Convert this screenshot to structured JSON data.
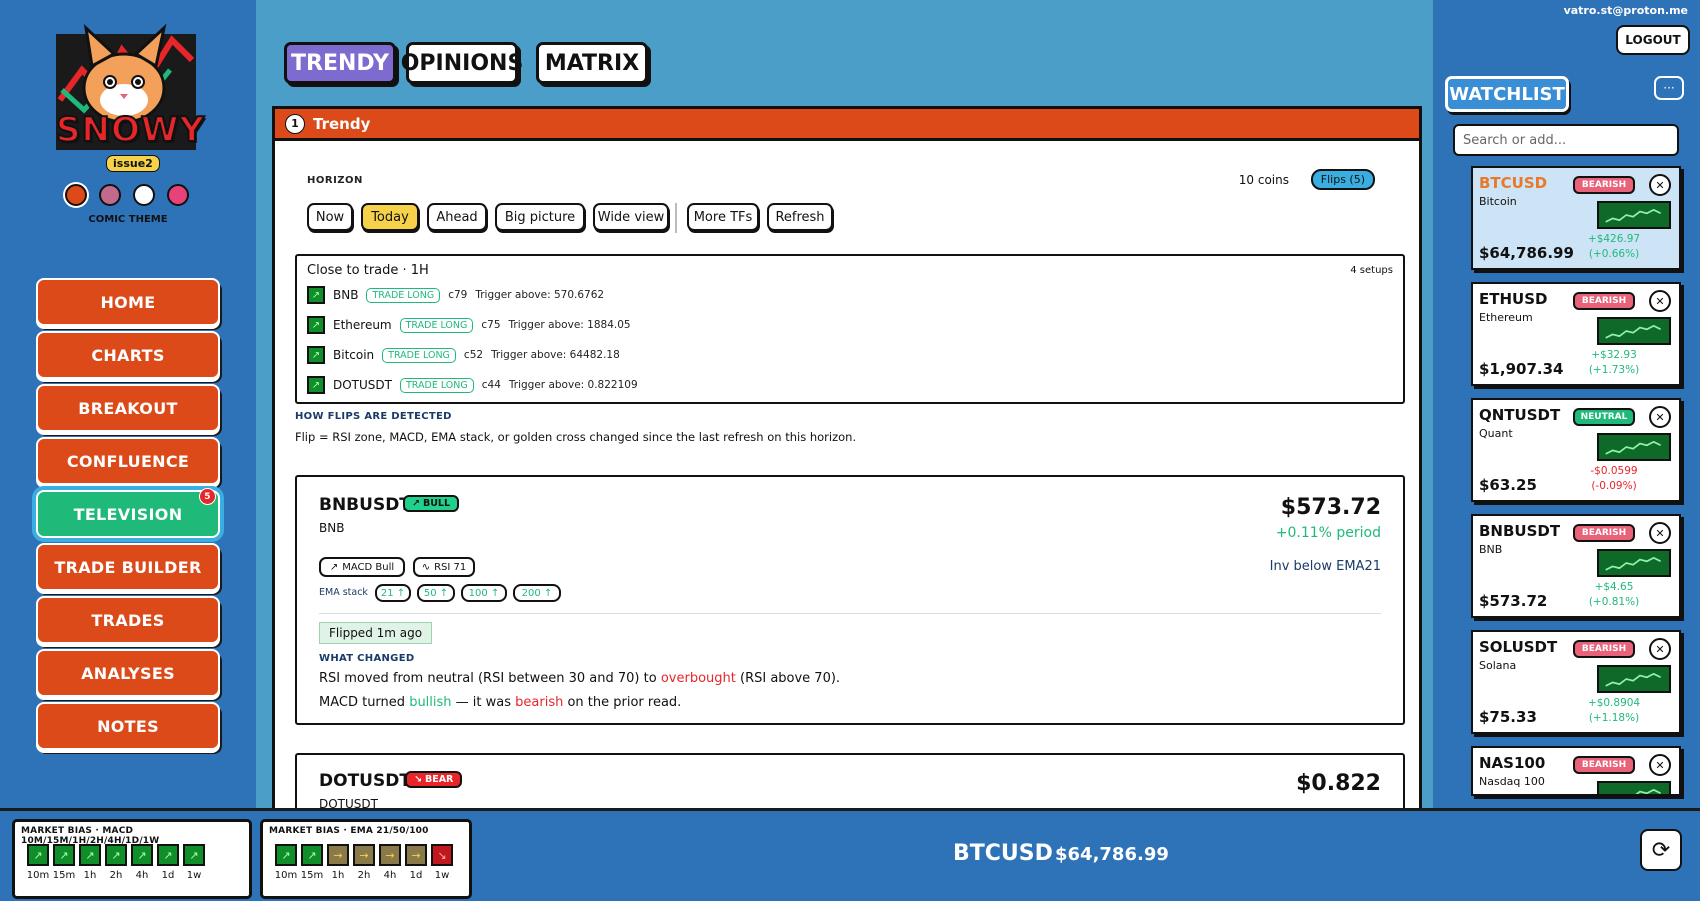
{
  "brand": {
    "logo_text": "SNOWY",
    "issue_label": "issue2",
    "theme_label": "COMIC THEME"
  },
  "colors": {
    "nav": "#dc4a1a",
    "nav_active": "#1fb97a",
    "bull": "#1fd18a",
    "bear": "#e8262a",
    "accent_tab": "#7d6bd0"
  },
  "themes": [
    "#dc4a1a",
    "#c26a8e",
    "#ffffff",
    "#e8427a"
  ],
  "nav": [
    {
      "label": "HOME"
    },
    {
      "label": "CHARTS"
    },
    {
      "label": "BREAKOUT"
    },
    {
      "label": "CONFLUENCE"
    },
    {
      "label": "TELEVISION",
      "badge": "5"
    },
    {
      "label": "TRADE BUILDER"
    },
    {
      "label": "TRADES"
    },
    {
      "label": "ANALYSES"
    },
    {
      "label": "NOTES"
    }
  ],
  "tabs": [
    "TRENDY",
    "OPINIONS",
    "MATRIX"
  ],
  "panel": {
    "num": "1",
    "title": "Trendy",
    "horizon_label": "HORIZON",
    "coins": "10 coins",
    "flips": "Flips (5)",
    "horizon_buttons": [
      "Now",
      "Today",
      "Ahead",
      "Big picture",
      "Wide view",
      "More TFs",
      "Refresh"
    ],
    "close_title": "Close to trade · 1H",
    "setups": "4 setups",
    "close_rows": [
      {
        "name": "BNB",
        "tag": "TRADE LONG",
        "conf": "c79",
        "trigger": "Trigger above: 570.6762"
      },
      {
        "name": "Ethereum",
        "tag": "TRADE LONG",
        "conf": "c75",
        "trigger": "Trigger above: 1884.05"
      },
      {
        "name": "Bitcoin",
        "tag": "TRADE LONG",
        "conf": "c52",
        "trigger": "Trigger above: 64482.18"
      },
      {
        "name": "DOTUSDT",
        "tag": "TRADE LONG",
        "conf": "c44",
        "trigger": "Trigger above: 0.822109"
      }
    ],
    "flip_title": "HOW FLIPS ARE DETECTED",
    "flip_desc": "Flip = RSI zone, MACD, EMA stack, or golden cross changed since the last refresh on this horizon."
  },
  "card1": {
    "symbol": "BNBUSDT",
    "badge": "BULL",
    "name": "BNB",
    "price": "$573.72",
    "pct": "+0.11% period",
    "macd": "MACD Bull",
    "rsi": "RSI 71",
    "inv": "Inv below EMA21",
    "ema_label": "EMA stack",
    "ema": [
      "21 ↑",
      "50 ↑",
      "100 ↑",
      "200 ↑"
    ],
    "flipped": "Flipped 1m ago",
    "what_changed": "WHAT CHANGED",
    "l1a": "RSI moved from neutral (RSI between 30 and 70) to ",
    "l1b": "overbought",
    "l1c": " (RSI above 70).",
    "l2a": "MACD turned ",
    "l2b": "bullish",
    "l2c": " — it was ",
    "l2d": "bearish",
    "l2e": " on the prior read."
  },
  "card2": {
    "symbol": "DOTUSDT",
    "badge": "BEAR",
    "name": "DOTUSDT",
    "price": "$0.822"
  },
  "right": {
    "email": "vatro.st@proton.me",
    "logout": "LOGOUT",
    "watchlist": "WATCHLIST",
    "more": "···",
    "search_placeholder": "Search or add..."
  },
  "watch": [
    {
      "sym": "BTCUSD",
      "name": "Bitcoin",
      "bias": "BEARISH",
      "ch1": "+$426.97",
      "ch2": "(+0.66%)",
      "price": "$64,786.99"
    },
    {
      "sym": "ETHUSD",
      "name": "Ethereum",
      "bias": "BEARISH",
      "ch1": "+$32.93",
      "ch2": "(+1.73%)",
      "price": "$1,907.34"
    },
    {
      "sym": "QNTUSDT",
      "name": "Quant",
      "bias": "NEUTRAL",
      "ch1": "-$0.0599",
      "ch2": "(-0.09%)",
      "price": "$63.25"
    },
    {
      "sym": "BNBUSDT",
      "name": "BNB",
      "bias": "BEARISH",
      "ch1": "+$4.65",
      "ch2": "(+0.81%)",
      "price": "$573.72"
    },
    {
      "sym": "SOLUSDT",
      "name": "Solana",
      "bias": "BEARISH",
      "ch1": "+$0.8904",
      "ch2": "(+1.18%)",
      "price": "$75.33"
    },
    {
      "sym": "NAS100",
      "name": "Nasdaq 100",
      "bias": "BEARISH",
      "ch1": "",
      "ch2": "",
      "price": ""
    }
  ],
  "bottom": {
    "macd_title": "MARKET BIAS · MACD 10M/15M/1H/2H/4H/1D/1W",
    "ema_title": "MARKET BIAS · EMA 21/50/100",
    "tfs": [
      "10m",
      "15m",
      "1h",
      "2h",
      "4h",
      "1d",
      "1w"
    ],
    "macd_states": [
      "up",
      "up",
      "up",
      "up",
      "up",
      "up",
      "up"
    ],
    "ema_states": [
      "up",
      "up",
      "flat",
      "flat",
      "flat",
      "flat",
      "down"
    ],
    "symbol": "BTCUSD",
    "price": "$64,786.99"
  }
}
